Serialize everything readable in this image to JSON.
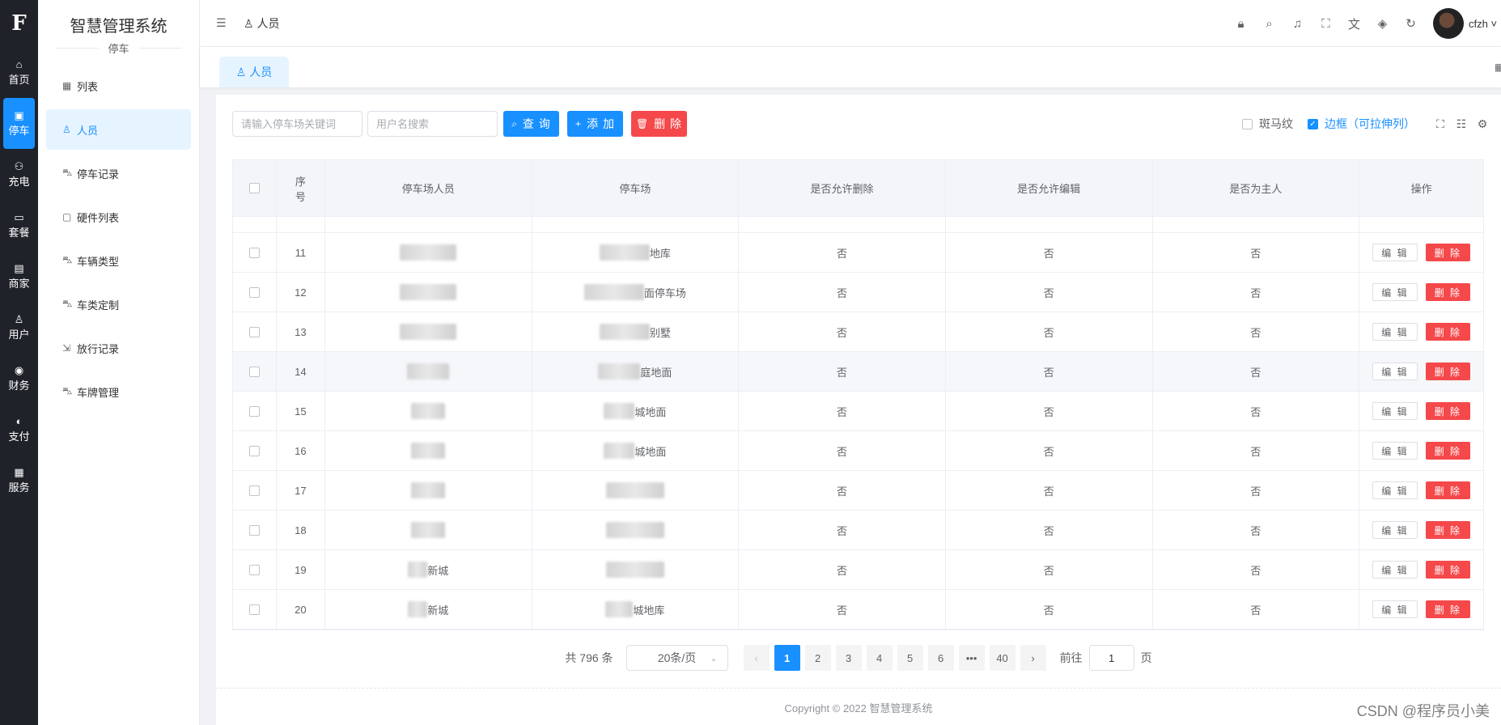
{
  "rail": {
    "logo": "F",
    "items": [
      {
        "icon": "home-icon",
        "glyph": "⌂",
        "label": "首页"
      },
      {
        "icon": "parking-icon",
        "glyph": "▣",
        "label": "停车"
      },
      {
        "icon": "charge-icon",
        "glyph": "⚇",
        "label": "充电"
      },
      {
        "icon": "package-icon",
        "glyph": "▭",
        "label": "套餐"
      },
      {
        "icon": "shop-icon",
        "glyph": "▤",
        "label": "商家"
      },
      {
        "icon": "user-icon",
        "glyph": "♙",
        "label": "用户"
      },
      {
        "icon": "finance-icon",
        "glyph": "◉",
        "label": "财务"
      },
      {
        "icon": "pay-icon",
        "glyph": "◐",
        "label": "支付"
      },
      {
        "icon": "service-icon",
        "glyph": "▦",
        "label": "服务"
      }
    ]
  },
  "submenu": {
    "title": "智慧管理系统",
    "subtitle": "停车",
    "items": [
      {
        "icon": "grid-icon",
        "glyph": "▦",
        "label": "列表"
      },
      {
        "icon": "person-icon",
        "glyph": "♙",
        "label": "人员"
      },
      {
        "icon": "car-icon",
        "glyph": "⛍",
        "label": "停车记录"
      },
      {
        "icon": "doc-icon",
        "glyph": "▢",
        "label": "硬件列表"
      },
      {
        "icon": "car-icon",
        "glyph": "⛍",
        "label": "车辆类型"
      },
      {
        "icon": "car-icon",
        "glyph": "⛍",
        "label": "车类定制"
      },
      {
        "icon": "exit-icon",
        "glyph": "⇲",
        "label": "放行记录"
      },
      {
        "icon": "car-icon",
        "glyph": "⛍",
        "label": "车牌管理"
      }
    ]
  },
  "header": {
    "breadcrumb": "人员",
    "username": "cfzh"
  },
  "tab": {
    "label": "人员"
  },
  "toolbar": {
    "search_lot_placeholder": "请输入停车场关键词",
    "search_user_placeholder": "用户名搜索",
    "query_label": "查 询",
    "add_label": "添 加",
    "delete_label": "删 除",
    "stripe_label": "斑马纹",
    "border_label": "边框（可拉伸列）"
  },
  "table": {
    "headers": [
      "序号",
      "停车场人员",
      "停车场",
      "是否允许删除",
      "是否允许编辑",
      "是否为主人",
      "操作"
    ],
    "edit_label": "编 辑",
    "delete_label": "删 除",
    "rows": [
      {
        "no": "11",
        "lot_suffix": "地库",
        "allow_delete": "否",
        "allow_edit": "否",
        "is_owner": "否"
      },
      {
        "no": "12",
        "lot_suffix": "面停车场",
        "allow_delete": "否",
        "allow_edit": "否",
        "is_owner": "否"
      },
      {
        "no": "13",
        "lot_suffix": "别墅",
        "allow_delete": "否",
        "allow_edit": "否",
        "is_owner": "否"
      },
      {
        "no": "14",
        "lot_suffix": "庭地面",
        "allow_delete": "否",
        "allow_edit": "否",
        "is_owner": "否"
      },
      {
        "no": "15",
        "lot_suffix": "城地面",
        "allow_delete": "否",
        "allow_edit": "否",
        "is_owner": "否"
      },
      {
        "no": "16",
        "lot_suffix": "城地面",
        "allow_delete": "否",
        "allow_edit": "否",
        "is_owner": "否"
      },
      {
        "no": "17",
        "lot_suffix": "",
        "allow_delete": "否",
        "allow_edit": "否",
        "is_owner": "否"
      },
      {
        "no": "18",
        "lot_suffix": "",
        "allow_delete": "否",
        "allow_edit": "否",
        "is_owner": "否"
      },
      {
        "no": "19",
        "person_suffix": "新城",
        "lot_suffix": "",
        "allow_delete": "否",
        "allow_edit": "否",
        "is_owner": "否"
      },
      {
        "no": "20",
        "person_suffix": "新城",
        "lot_suffix": "城地库",
        "allow_delete": "否",
        "allow_edit": "否",
        "is_owner": "否"
      }
    ]
  },
  "pagination": {
    "total": "共 796 条",
    "page_size": "20条/页",
    "pages": [
      "1",
      "2",
      "3",
      "4",
      "5",
      "6",
      "•••",
      "40"
    ],
    "current": "1",
    "goto_label": "前往",
    "goto_value": "1",
    "page_unit": "页"
  },
  "footer": "Copyright © 2022 智慧管理系统",
  "watermark": "CSDN @程序员小美"
}
